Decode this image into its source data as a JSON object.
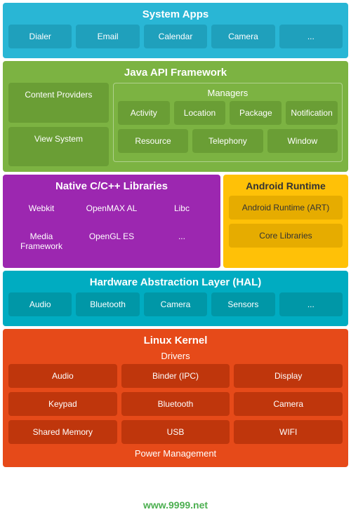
{
  "systemApps": {
    "title": "System Apps",
    "items": [
      "Dialer",
      "Email",
      "Calendar",
      "Camera",
      "..."
    ]
  },
  "javaApi": {
    "title": "Java API Framework",
    "contentProviders": "Content Providers",
    "viewSystem": "View System",
    "managersTitle": "Managers",
    "managers": [
      "Activity",
      "Location",
      "Package",
      "Notification",
      "Resource",
      "Telephony",
      "Window"
    ]
  },
  "nativeLibs": {
    "title": "Native C/C++ Libraries",
    "items": [
      "Webkit",
      "OpenMAX AL",
      "Libc",
      "Media Framework",
      "OpenGL ES",
      "..."
    ]
  },
  "androidRuntime": {
    "title": "Android Runtime",
    "items": [
      "Android Runtime (ART)",
      "Core Libraries"
    ]
  },
  "hal": {
    "title": "Hardware Abstraction Layer (HAL)",
    "items": [
      "Audio",
      "Bluetooth",
      "Camera",
      "Sensors",
      "..."
    ]
  },
  "linuxKernel": {
    "title": "Linux Kernel",
    "driversTitle": "Drivers",
    "drivers": [
      "Audio",
      "Binder (IPC)",
      "Display",
      "Keypad",
      "Bluetooth",
      "Camera",
      "Shared Memory",
      "USB",
      "WIFI"
    ],
    "powerManagement": "Power Management"
  },
  "watermark": "www.9999.net"
}
